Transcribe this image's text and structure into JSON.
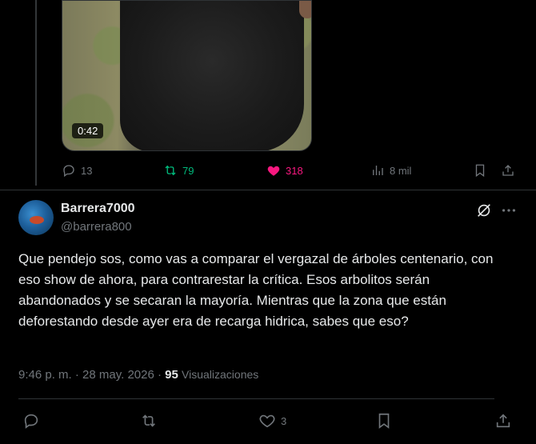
{
  "previous_tweet": {
    "video_duration": "0:42",
    "metrics": {
      "replies": "13",
      "retweets": "79",
      "likes": "318",
      "views": "8 mil"
    }
  },
  "reply": {
    "display_name": "Barrera7000",
    "handle": "@barrera800",
    "text": "Que pendejo sos, como vas a comparar  el vergazal de árboles centenario, con eso show de ahora, para contrarestar  la crítica. Esos arbolitos serán abandonados y se secaran la mayoría. Mientras que la zona que están deforestando desde ayer  era de recarga hidrica, sabes que eso?",
    "time": "9:46 p. m.",
    "separator": "·",
    "date": "28 may. 2026",
    "views_count": "95",
    "views_label": "Visualizaciones",
    "likes": "3"
  },
  "colors": {
    "background": "#000000",
    "text": "#e7e9ea",
    "muted": "#71767b",
    "retweet_active": "#00ba7c",
    "like_active": "#f91880",
    "divider": "#2f3336"
  },
  "icons": [
    "reply-icon",
    "retweet-icon",
    "like-icon",
    "views-icon",
    "bookmark-icon",
    "share-icon",
    "grok-icon",
    "more-icon"
  ]
}
